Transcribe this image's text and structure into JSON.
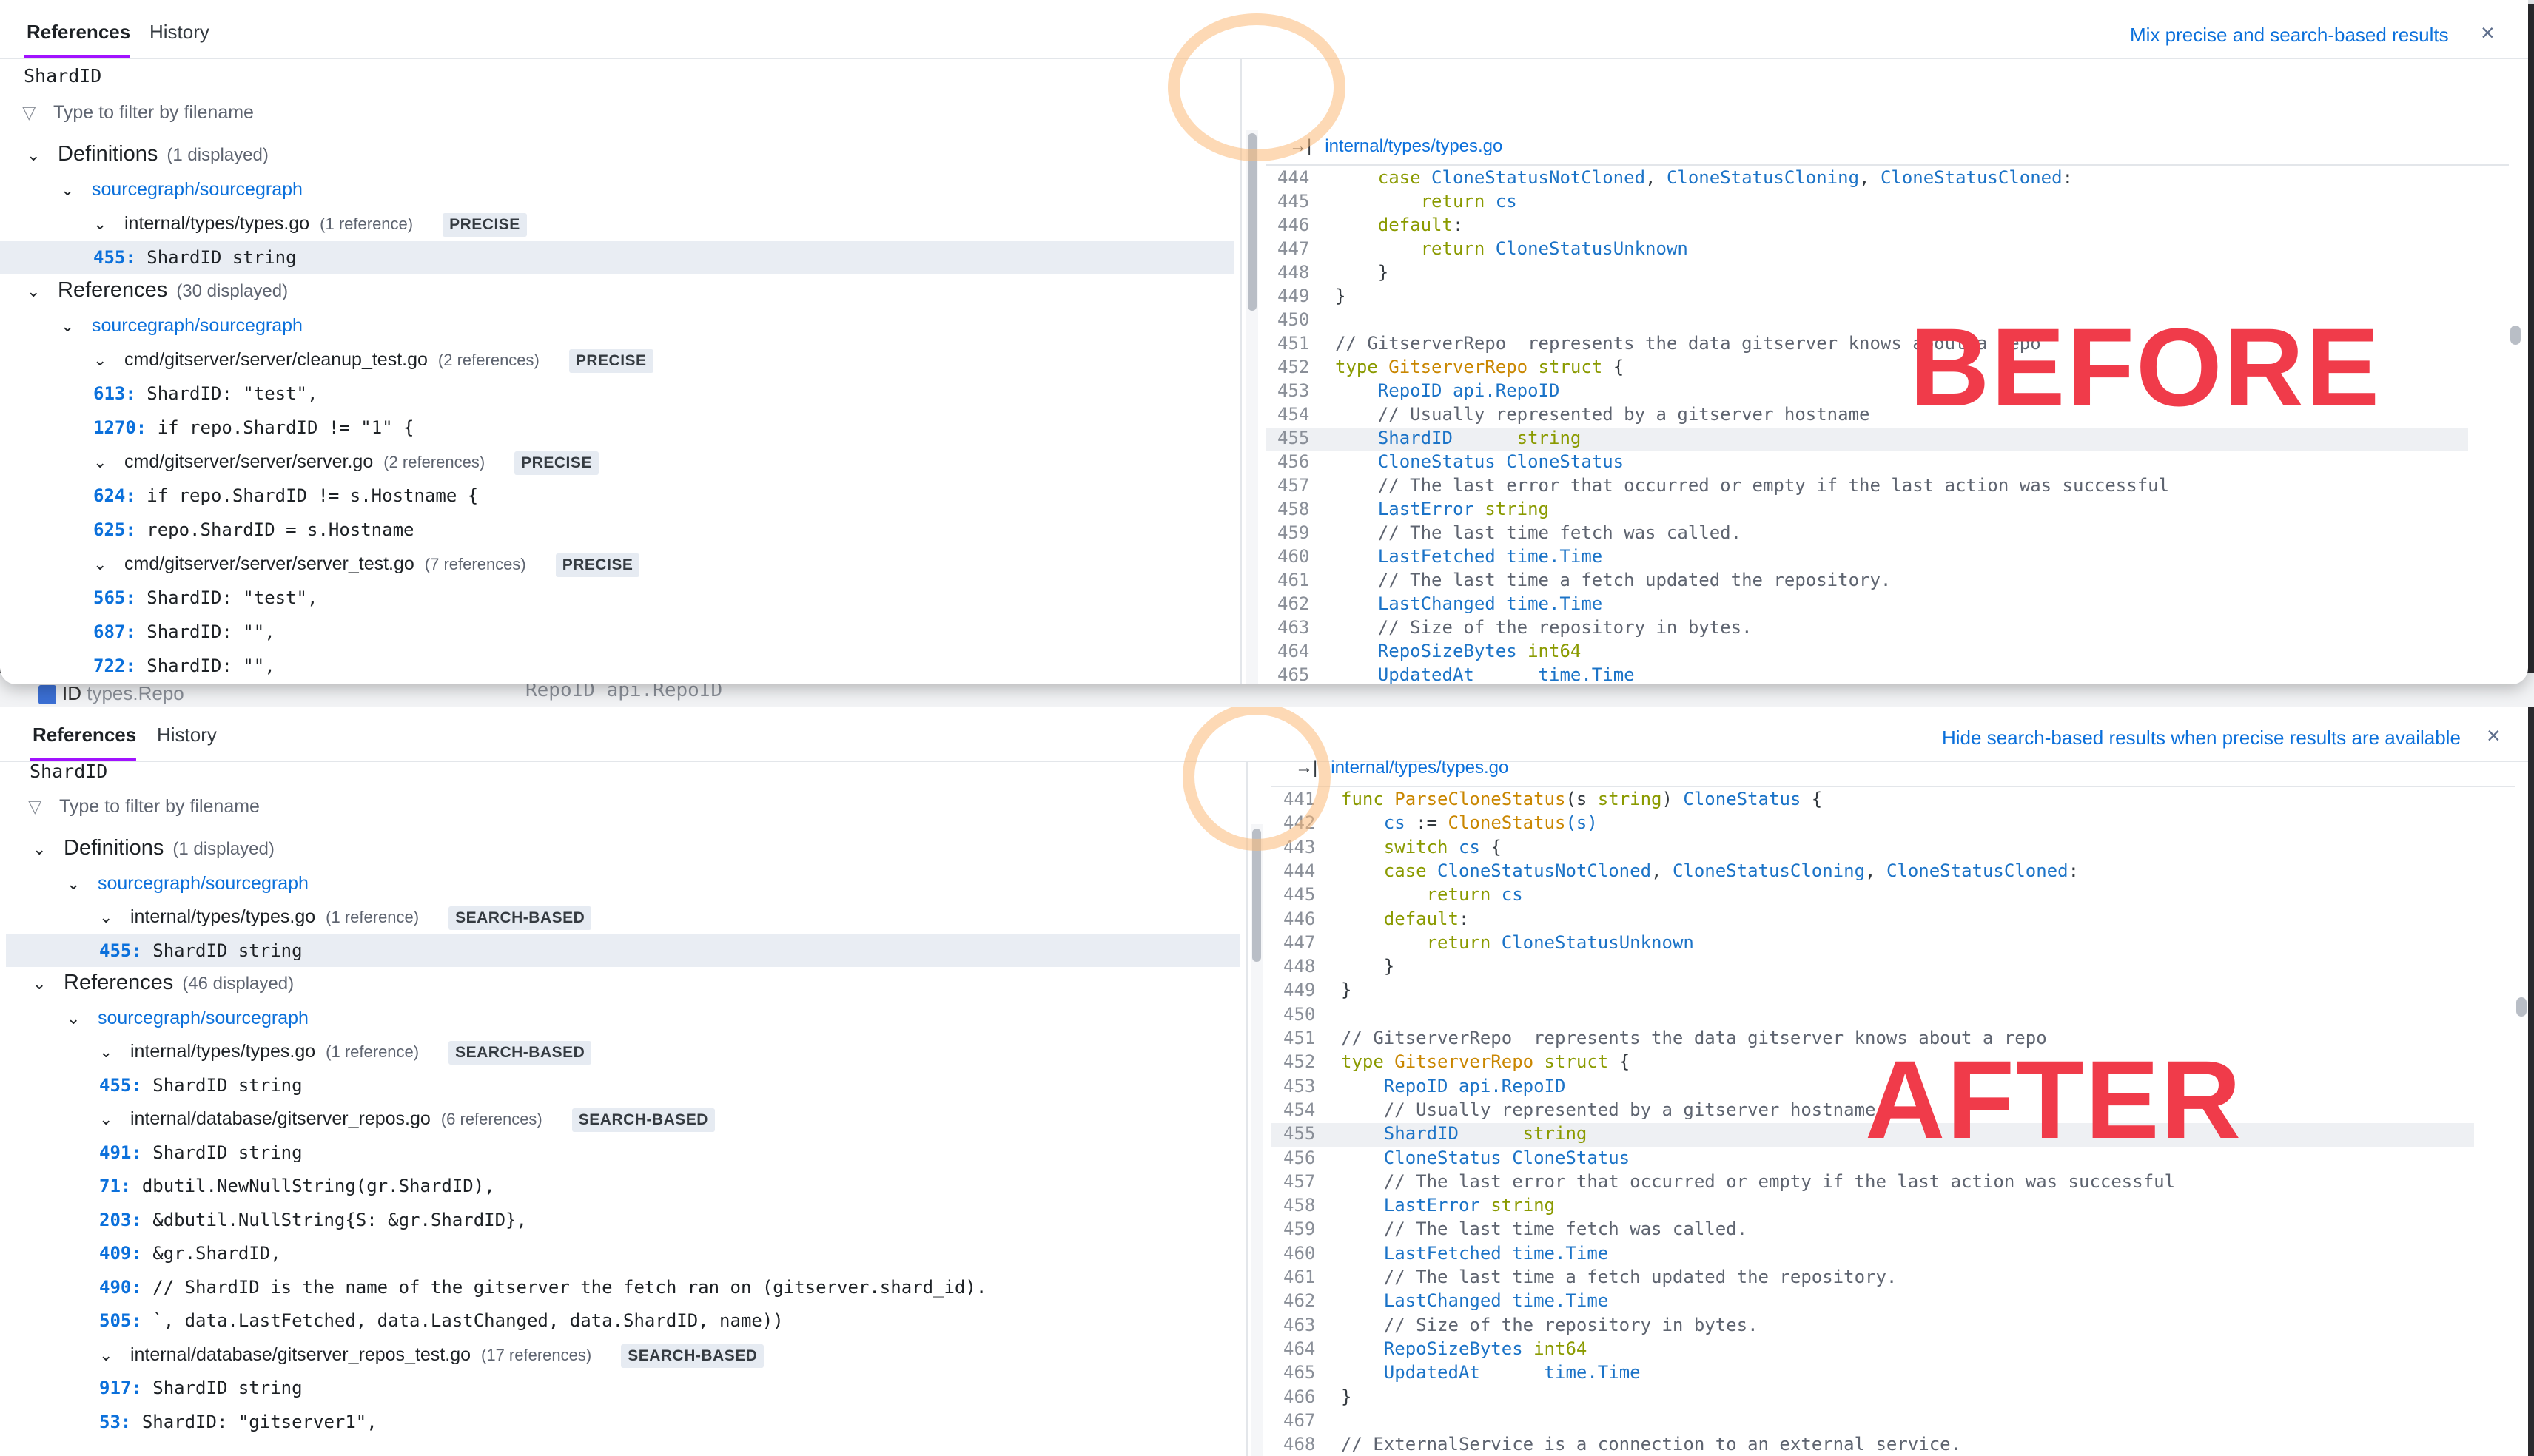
{
  "tabs": {
    "references": "References",
    "history": "History"
  },
  "close_glyph": "×",
  "symbol": "ShardID",
  "filter_placeholder": "Type to filter by filename",
  "before": {
    "toggle_link": "Mix precise and search-based results",
    "label": "BEFORE",
    "file_path": "internal/types/types.go",
    "definitions": {
      "title": "Definitions",
      "count": "(1 displayed)",
      "repo": "sourcegraph/sourcegraph",
      "files": [
        {
          "path": "internal/types/types.go",
          "refs": "(1 reference)",
          "badge": "PRECISE",
          "lines": [
            {
              "num": "455:",
              "code": "ShardID      string"
            }
          ]
        }
      ]
    },
    "references": {
      "title": "References",
      "count": "(30 displayed)",
      "repo": "sourcegraph/sourcegraph",
      "files": [
        {
          "path": "cmd/gitserver/server/cleanup_test.go",
          "refs": "(2 references)",
          "badge": "PRECISE",
          "lines": [
            {
              "num": "613:",
              "code": "ShardID:      \"test\","
            },
            {
              "num": "1270:",
              "code": "if repo.ShardID != \"1\" {"
            }
          ]
        },
        {
          "path": "cmd/gitserver/server/server.go",
          "refs": "(2 references)",
          "badge": "PRECISE",
          "lines": [
            {
              "num": "624:",
              "code": "if repo.ShardID != s.Hostname {"
            },
            {
              "num": "625:",
              "code": "repo.ShardID = s.Hostname"
            }
          ]
        },
        {
          "path": "cmd/gitserver/server/server_test.go",
          "refs": "(7 references)",
          "badge": "PRECISE",
          "lines": [
            {
              "num": "565:",
              "code": "ShardID:      \"test\","
            },
            {
              "num": "687:",
              "code": "ShardID:       \"\","
            },
            {
              "num": "722:",
              "code": "ShardID:       \"\","
            }
          ]
        }
      ]
    },
    "code_lines": [
      {
        "n": "444",
        "c": [
          [
            "    ",
            ""
          ],
          [
            "case ",
            "kw"
          ],
          [
            "CloneStatusNotCloned",
            "id"
          ],
          [
            ", ",
            "tx"
          ],
          [
            "CloneStatusCloning",
            "id"
          ],
          [
            ", ",
            "tx"
          ],
          [
            "CloneStatusCloned",
            "id"
          ],
          [
            ":",
            "tx"
          ]
        ]
      },
      {
        "n": "445",
        "c": [
          [
            "        ",
            ""
          ],
          [
            "return ",
            "kw"
          ],
          [
            "cs",
            "id"
          ]
        ]
      },
      {
        "n": "446",
        "c": [
          [
            "    ",
            ""
          ],
          [
            "default",
            "kw"
          ],
          [
            ":",
            "tx"
          ]
        ]
      },
      {
        "n": "447",
        "c": [
          [
            "        ",
            ""
          ],
          [
            "return ",
            "kw"
          ],
          [
            "CloneStatusUnknown",
            "id"
          ]
        ]
      },
      {
        "n": "448",
        "c": [
          [
            "    }",
            "tx"
          ]
        ]
      },
      {
        "n": "449",
        "c": [
          [
            "}",
            "tx"
          ]
        ]
      },
      {
        "n": "450",
        "c": []
      },
      {
        "n": "451",
        "c": [
          [
            "// GitserverRepo  represents the data gitserver knows about a repo",
            "cm"
          ]
        ]
      },
      {
        "n": "452",
        "c": [
          [
            "type ",
            "kw"
          ],
          [
            "GitserverRepo ",
            "fn"
          ],
          [
            "struct ",
            "kw"
          ],
          [
            "{",
            "tx"
          ]
        ]
      },
      {
        "n": "453",
        "c": [
          [
            "    ",
            ""
          ],
          [
            "RepoID ",
            "id"
          ],
          [
            "api.RepoID",
            "ty"
          ]
        ]
      },
      {
        "n": "454",
        "c": [
          [
            "    // Usually represented by a gitserver hostname",
            "cm"
          ]
        ]
      },
      {
        "n": "455",
        "c": [
          [
            "    ",
            ""
          ],
          [
            "ShardID      ",
            "id"
          ],
          [
            "string",
            "kw"
          ]
        ],
        "hl": true
      },
      {
        "n": "456",
        "c": [
          [
            "    ",
            ""
          ],
          [
            "CloneStatus ",
            "id"
          ],
          [
            "CloneStatus",
            "ty"
          ]
        ]
      },
      {
        "n": "457",
        "c": [
          [
            "    // The last error that occurred or empty if the last action was successful",
            "cm"
          ]
        ]
      },
      {
        "n": "458",
        "c": [
          [
            "    ",
            ""
          ],
          [
            "LastError ",
            "id"
          ],
          [
            "string",
            "kw"
          ]
        ]
      },
      {
        "n": "459",
        "c": [
          [
            "    // The last time fetch was called.",
            "cm"
          ]
        ]
      },
      {
        "n": "460",
        "c": [
          [
            "    ",
            ""
          ],
          [
            "LastFetched ",
            "id"
          ],
          [
            "time.Time",
            "ty"
          ]
        ]
      },
      {
        "n": "461",
        "c": [
          [
            "    // The last time a fetch updated the repository.",
            "cm"
          ]
        ]
      },
      {
        "n": "462",
        "c": [
          [
            "    ",
            ""
          ],
          [
            "LastChanged ",
            "id"
          ],
          [
            "time.Time",
            "ty"
          ]
        ]
      },
      {
        "n": "463",
        "c": [
          [
            "    // Size of the repository in bytes.",
            "cm"
          ]
        ]
      },
      {
        "n": "464",
        "c": [
          [
            "    ",
            ""
          ],
          [
            "RepoSizeBytes ",
            "id"
          ],
          [
            "int64",
            "kw"
          ]
        ]
      },
      {
        "n": "465",
        "c": [
          [
            "    ",
            ""
          ],
          [
            "UpdatedAt      ",
            "id"
          ],
          [
            "time.Time",
            "ty"
          ]
        ]
      }
    ]
  },
  "after": {
    "toggle_link": "Hide search-based results when precise results are available",
    "label": "AFTER",
    "file_path": "internal/types/types.go",
    "definitions": {
      "title": "Definitions",
      "count": "(1 displayed)",
      "repo": "sourcegraph/sourcegraph",
      "files": [
        {
          "path": "internal/types/types.go",
          "refs": "(1 reference)",
          "badge": "SEARCH-BASED",
          "lines": [
            {
              "num": "455:",
              "code": "ShardID      string"
            }
          ]
        }
      ]
    },
    "references": {
      "title": "References",
      "count": "(46 displayed)",
      "repo": "sourcegraph/sourcegraph",
      "files": [
        {
          "path": "internal/types/types.go",
          "refs": "(1 reference)",
          "badge": "SEARCH-BASED",
          "lines": [
            {
              "num": "455:",
              "code": "ShardID      string"
            }
          ]
        },
        {
          "path": "internal/database/gitserver_repos.go",
          "refs": "(6 references)",
          "badge": "SEARCH-BASED",
          "lines": [
            {
              "num": "491:",
              "code": "ShardID string"
            },
            {
              "num": "71:",
              "code": "dbutil.NewNullString(gr.ShardID),"
            },
            {
              "num": "203:",
              "code": "&dbutil.NullString{S: &gr.ShardID},"
            },
            {
              "num": "409:",
              "code": "&gr.ShardID,"
            },
            {
              "num": "490:",
              "code": "// ShardID is the name of the gitserver the fetch ran on (gitserver.shard_id)."
            },
            {
              "num": "505:",
              "code": "`, data.LastFetched, data.LastChanged, data.ShardID, name))"
            }
          ]
        },
        {
          "path": "internal/database/gitserver_repos_test.go",
          "refs": "(17 references)",
          "badge": "SEARCH-BASED",
          "lines": [
            {
              "num": "917:",
              "code": "ShardID      string"
            },
            {
              "num": "53:",
              "code": "ShardID:        \"gitserver1\","
            }
          ]
        }
      ]
    },
    "code_lines": [
      {
        "n": "441",
        "c": [
          [
            "func ",
            "kw"
          ],
          [
            "ParseCloneStatus",
            "fn"
          ],
          [
            "(s ",
            "tx"
          ],
          [
            "string",
            "kw"
          ],
          [
            ") ",
            "tx"
          ],
          [
            "CloneStatus ",
            "ty"
          ],
          [
            "{",
            "tx"
          ]
        ]
      },
      {
        "n": "442",
        "c": [
          [
            "    ",
            ""
          ],
          [
            "cs ",
            "id"
          ],
          [
            ":= ",
            "tx"
          ],
          [
            "CloneStatus",
            "fn"
          ],
          [
            "(s)",
            "id"
          ]
        ]
      },
      {
        "n": "443",
        "c": [
          [
            "    ",
            ""
          ],
          [
            "switch ",
            "kw"
          ],
          [
            "cs ",
            "id"
          ],
          [
            "{",
            "tx"
          ]
        ]
      },
      {
        "n": "444",
        "c": [
          [
            "    ",
            ""
          ],
          [
            "case ",
            "kw"
          ],
          [
            "CloneStatusNotCloned",
            "id"
          ],
          [
            ", ",
            "tx"
          ],
          [
            "CloneStatusCloning",
            "id"
          ],
          [
            ", ",
            "tx"
          ],
          [
            "CloneStatusCloned",
            "id"
          ],
          [
            ":",
            "tx"
          ]
        ]
      },
      {
        "n": "445",
        "c": [
          [
            "        ",
            ""
          ],
          [
            "return ",
            "kw"
          ],
          [
            "cs",
            "id"
          ]
        ]
      },
      {
        "n": "446",
        "c": [
          [
            "    ",
            ""
          ],
          [
            "default",
            "kw"
          ],
          [
            ":",
            "tx"
          ]
        ]
      },
      {
        "n": "447",
        "c": [
          [
            "        ",
            ""
          ],
          [
            "return ",
            "kw"
          ],
          [
            "CloneStatusUnknown",
            "id"
          ]
        ]
      },
      {
        "n": "448",
        "c": [
          [
            "    }",
            "tx"
          ]
        ]
      },
      {
        "n": "449",
        "c": [
          [
            "}",
            "tx"
          ]
        ]
      },
      {
        "n": "450",
        "c": []
      },
      {
        "n": "451",
        "c": [
          [
            "// GitserverRepo  represents the data gitserver knows about a repo",
            "cm"
          ]
        ]
      },
      {
        "n": "452",
        "c": [
          [
            "type ",
            "kw"
          ],
          [
            "GitserverRepo ",
            "fn"
          ],
          [
            "struct ",
            "kw"
          ],
          [
            "{",
            "tx"
          ]
        ]
      },
      {
        "n": "453",
        "c": [
          [
            "    ",
            ""
          ],
          [
            "RepoID ",
            "id"
          ],
          [
            "api.RepoID",
            "ty"
          ]
        ]
      },
      {
        "n": "454",
        "c": [
          [
            "    // Usually represented by a gitserver hostname",
            "cm"
          ]
        ]
      },
      {
        "n": "455",
        "c": [
          [
            "    ",
            ""
          ],
          [
            "ShardID      ",
            "id"
          ],
          [
            "string",
            "kw"
          ]
        ],
        "hl": true
      },
      {
        "n": "456",
        "c": [
          [
            "    ",
            ""
          ],
          [
            "CloneStatus ",
            "id"
          ],
          [
            "CloneStatus",
            "ty"
          ]
        ]
      },
      {
        "n": "457",
        "c": [
          [
            "    // The last error that occurred or empty if the last action was successful",
            "cm"
          ]
        ]
      },
      {
        "n": "458",
        "c": [
          [
            "    ",
            ""
          ],
          [
            "LastError ",
            "id"
          ],
          [
            "string",
            "kw"
          ]
        ]
      },
      {
        "n": "459",
        "c": [
          [
            "    // The last time fetch was called.",
            "cm"
          ]
        ]
      },
      {
        "n": "460",
        "c": [
          [
            "    ",
            ""
          ],
          [
            "LastFetched ",
            "id"
          ],
          [
            "time.Time",
            "ty"
          ]
        ]
      },
      {
        "n": "461",
        "c": [
          [
            "    // The last time a fetch updated the repository.",
            "cm"
          ]
        ]
      },
      {
        "n": "462",
        "c": [
          [
            "    ",
            ""
          ],
          [
            "LastChanged ",
            "id"
          ],
          [
            "time.Time",
            "ty"
          ]
        ]
      },
      {
        "n": "463",
        "c": [
          [
            "    // Size of the repository in bytes.",
            "cm"
          ]
        ]
      },
      {
        "n": "464",
        "c": [
          [
            "    ",
            ""
          ],
          [
            "RepoSizeBytes ",
            "id"
          ],
          [
            "int64",
            "kw"
          ]
        ]
      },
      {
        "n": "465",
        "c": [
          [
            "    ",
            ""
          ],
          [
            "UpdatedAt      ",
            "id"
          ],
          [
            "time.Time",
            "ty"
          ]
        ]
      },
      {
        "n": "466",
        "c": [
          [
            "}",
            "tx"
          ]
        ]
      },
      {
        "n": "467",
        "c": []
      },
      {
        "n": "468",
        "c": [
          [
            "// ExternalService is a connection to an external service.",
            "cm"
          ]
        ]
      }
    ]
  },
  "background": {
    "peek_symbol": "ID",
    "peek_type": "types.Repo",
    "peek_code": "RepoID api.RepoID"
  }
}
